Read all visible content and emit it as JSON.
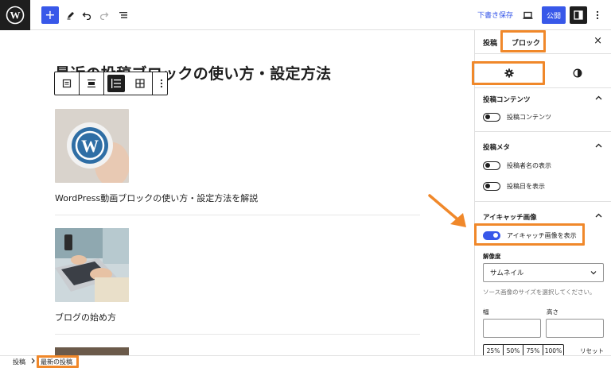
{
  "toolbar": {
    "save_draft_label": "下書き保存",
    "publish_label": "公開"
  },
  "editor": {
    "title": "最近の投稿ブロックの使い方・設定方法",
    "posts": [
      {
        "title": "WordPress動画ブロックの使い方・設定方法を解説"
      },
      {
        "title": "ブログの始め方"
      }
    ]
  },
  "sidebar": {
    "tabs": [
      "投稿",
      "ブロック"
    ],
    "panels": {
      "content": {
        "title": "投稿コンテンツ",
        "toggle": "投稿コンテンツ"
      },
      "meta": {
        "title": "投稿メタ",
        "toggles": [
          "投稿者名の表示",
          "投稿日を表示"
        ]
      },
      "featured": {
        "title": "アイキャッチ画像",
        "toggle": "アイキャッチ画像を表示",
        "resolution_label": "解像度",
        "resolution_value": "サムネイル",
        "resolution_help": "ソース画像のサイズを選択してください。",
        "width_label": "幅",
        "height_label": "高さ",
        "percents": [
          "25%",
          "50%",
          "75%",
          "100%"
        ],
        "reset_label": "リセット"
      }
    }
  },
  "breadcrumb": [
    "投稿",
    "最新の投稿"
  ],
  "colors": {
    "accent": "#3858e9",
    "highlight": "#f0882a",
    "arrow": "#f0882a"
  }
}
